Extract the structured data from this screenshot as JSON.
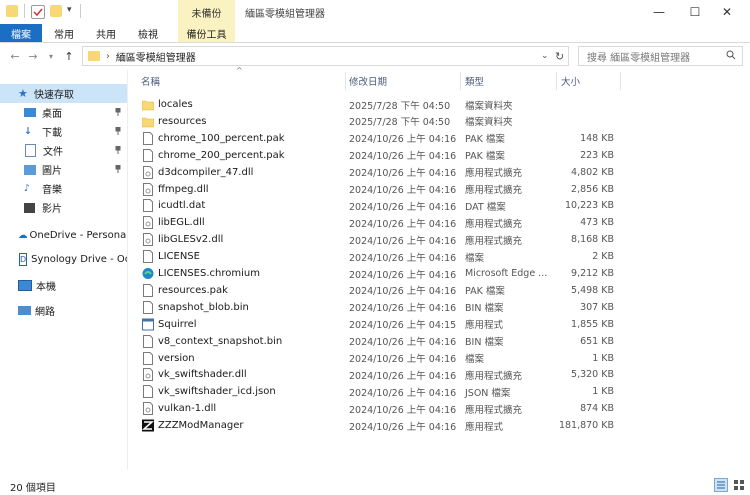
{
  "window": {
    "title": "緬區零模組管理器",
    "context_tab_group": "未備份",
    "controls": {
      "minimize": "—",
      "maximize": "☐",
      "close": "✕"
    }
  },
  "ribbon": {
    "tabs": [
      "檔案",
      "常用",
      "共用",
      "檢視",
      "備份工具"
    ]
  },
  "address": {
    "path": "緬區零模組管理器",
    "search_placeholder": "搜尋 緬區零模組管理器"
  },
  "nav": {
    "quick_access": "快速存取",
    "pinned": [
      "桌面",
      "下載",
      "文件",
      "圖片"
    ],
    "items": [
      "音樂",
      "影片"
    ],
    "onedrive": "OneDrive - Personal",
    "synology": "Synology Drive - Oc",
    "this_pc": "本機",
    "network": "網路"
  },
  "columns": {
    "name": "名稱",
    "date": "修改日期",
    "type": "類型",
    "size": "大小"
  },
  "files": [
    {
      "name": "locales",
      "date": "2025/7/28 下午 04:50",
      "type": "檔案資料夾",
      "size": "",
      "icon": "folder-icon"
    },
    {
      "name": "resources",
      "date": "2025/7/28 下午 04:50",
      "type": "檔案資料夾",
      "size": "",
      "icon": "folder-icon"
    },
    {
      "name": "chrome_100_percent.pak",
      "date": "2024/10/26 上午 04:16",
      "type": "PAK 檔案",
      "size": "148 KB",
      "icon": "file-icon"
    },
    {
      "name": "chrome_200_percent.pak",
      "date": "2024/10/26 上午 04:16",
      "type": "PAK 檔案",
      "size": "223 KB",
      "icon": "file-icon"
    },
    {
      "name": "d3dcompiler_47.dll",
      "date": "2024/10/26 上午 04:16",
      "type": "應用程式擴充",
      "size": "4,802 KB",
      "icon": "dll-icon"
    },
    {
      "name": "ffmpeg.dll",
      "date": "2024/10/26 上午 04:16",
      "type": "應用程式擴充",
      "size": "2,856 KB",
      "icon": "dll-icon"
    },
    {
      "name": "icudtl.dat",
      "date": "2024/10/26 上午 04:16",
      "type": "DAT 檔案",
      "size": "10,223 KB",
      "icon": "file-icon"
    },
    {
      "name": "libEGL.dll",
      "date": "2024/10/26 上午 04:16",
      "type": "應用程式擴充",
      "size": "473 KB",
      "icon": "dll-icon"
    },
    {
      "name": "libGLESv2.dll",
      "date": "2024/10/26 上午 04:16",
      "type": "應用程式擴充",
      "size": "8,168 KB",
      "icon": "dll-icon"
    },
    {
      "name": "LICENSE",
      "date": "2024/10/26 上午 04:16",
      "type": "檔案",
      "size": "2 KB",
      "icon": "file-icon"
    },
    {
      "name": "LICENSES.chromium",
      "date": "2024/10/26 上午 04:16",
      "type": "Microsoft Edge ...",
      "size": "9,212 KB",
      "icon": "edge-icon"
    },
    {
      "name": "resources.pak",
      "date": "2024/10/26 上午 04:16",
      "type": "PAK 檔案",
      "size": "5,498 KB",
      "icon": "file-icon"
    },
    {
      "name": "snapshot_blob.bin",
      "date": "2024/10/26 上午 04:16",
      "type": "BIN 檔案",
      "size": "307 KB",
      "icon": "file-icon"
    },
    {
      "name": "Squirrel",
      "date": "2024/10/26 上午 04:15",
      "type": "應用程式",
      "size": "1,855 KB",
      "icon": "app-icon"
    },
    {
      "name": "v8_context_snapshot.bin",
      "date": "2024/10/26 上午 04:16",
      "type": "BIN 檔案",
      "size": "651 KB",
      "icon": "file-icon"
    },
    {
      "name": "version",
      "date": "2024/10/26 上午 04:16",
      "type": "檔案",
      "size": "1 KB",
      "icon": "file-icon"
    },
    {
      "name": "vk_swiftshader.dll",
      "date": "2024/10/26 上午 04:16",
      "type": "應用程式擴充",
      "size": "5,320 KB",
      "icon": "dll-icon"
    },
    {
      "name": "vk_swiftshader_icd.json",
      "date": "2024/10/26 上午 04:16",
      "type": "JSON 檔案",
      "size": "1 KB",
      "icon": "file-icon"
    },
    {
      "name": "vulkan-1.dll",
      "date": "2024/10/26 上午 04:16",
      "type": "應用程式擴充",
      "size": "874 KB",
      "icon": "dll-icon"
    },
    {
      "name": "ZZZModManager",
      "date": "2024/10/26 上午 04:16",
      "type": "應用程式",
      "size": "181,870 KB",
      "icon": "zzz-app-icon"
    }
  ],
  "status": {
    "item_count": "20 個項目"
  },
  "colors": {
    "accent": "#1a6fc4",
    "context_tab": "#fbf2c2",
    "selection": "#cce4f7",
    "folder": "#f8d775"
  }
}
